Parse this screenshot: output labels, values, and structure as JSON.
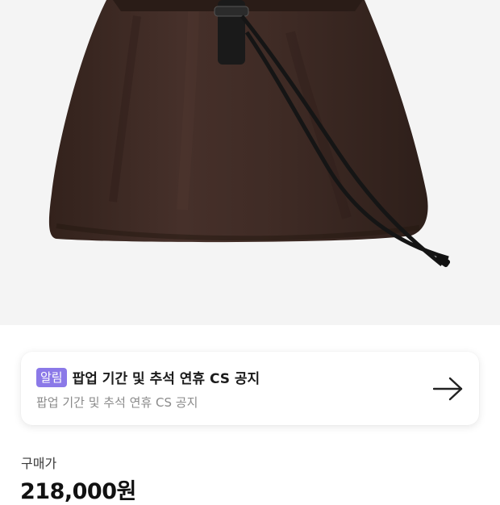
{
  "product": {
    "image_alt": "brown nylon drawstring bag with black leather strap",
    "image_background": "#f4f4f4",
    "bag_color": "#3e2a24",
    "strap_color": "#1a1a1a"
  },
  "notice": {
    "badge": "알림",
    "badge_color": "#8b79e8",
    "title": "팝업 기간 및 추석 연휴 CS 공지",
    "subtitle": "팝업 기간 및 추석 연휴 CS 공지",
    "icon": "arrow-right-icon"
  },
  "price": {
    "label": "구매가",
    "value": "218,000원"
  }
}
